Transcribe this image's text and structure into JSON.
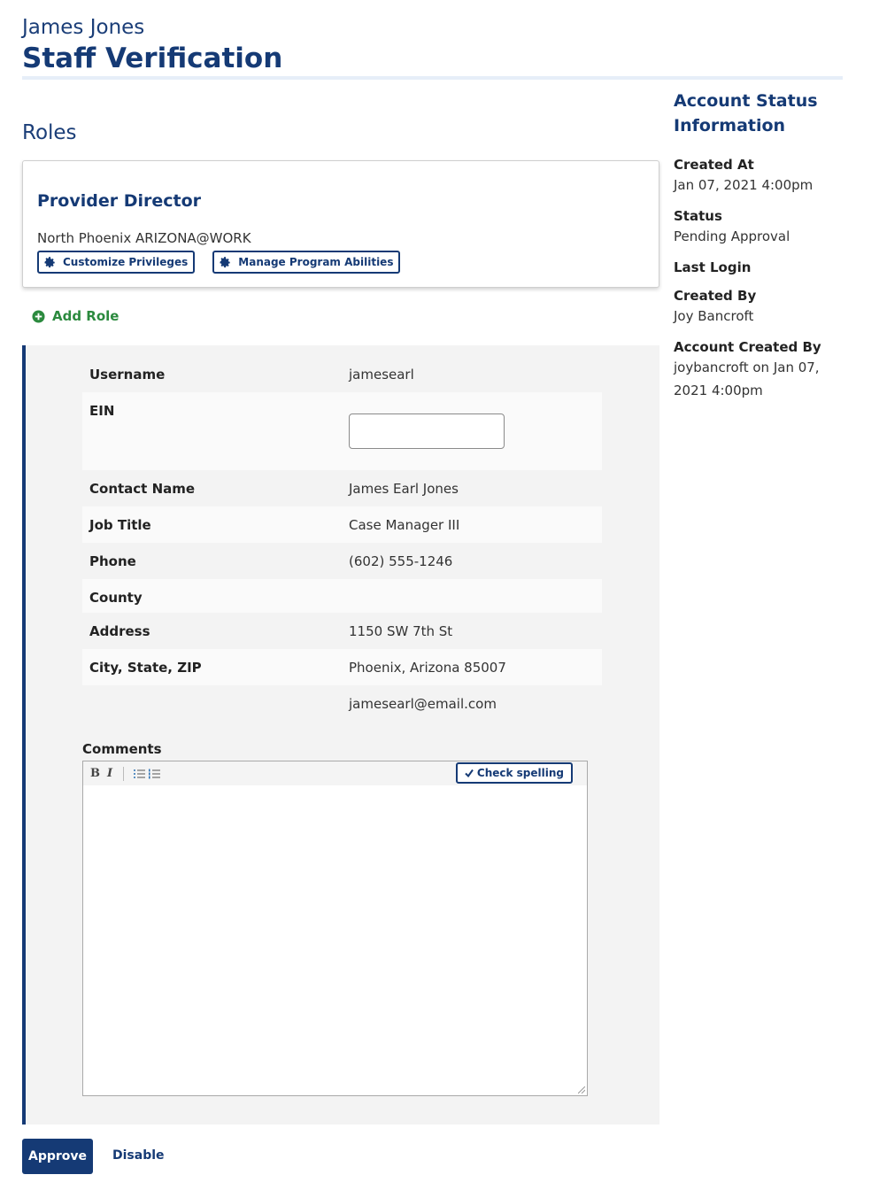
{
  "header": {
    "person_name": "James Jones",
    "page_title": "Staff Verification"
  },
  "roles": {
    "heading": "Roles",
    "items": [
      {
        "title": "Provider Director",
        "location": "North Phoenix ARIZONA@WORK",
        "customize_label": "Customize Privileges",
        "manage_label": "Manage Program Abilities"
      }
    ],
    "add_role_label": "Add Role"
  },
  "details": {
    "rows": [
      {
        "label": "Username",
        "value": "jamesearl"
      },
      {
        "label": "EIN",
        "value": ""
      },
      {
        "label": "Contact Name",
        "value": "James Earl Jones"
      },
      {
        "label": "Job Title",
        "value": "Case Manager III"
      },
      {
        "label": "Phone",
        "value": "(602) 555-1246"
      },
      {
        "label": "County",
        "value": ""
      },
      {
        "label": "Address",
        "value": "1150 SW 7th St"
      },
      {
        "label": "City, State, ZIP",
        "value": "Phoenix, Arizona 85007"
      },
      {
        "label": "",
        "value": "jamesearl@email.com"
      }
    ],
    "comments_label": "Comments",
    "toolbar": {
      "bold": "B",
      "italic": "I",
      "spell_label": "Check spelling"
    }
  },
  "actions": {
    "approve_label": "Approve",
    "disable_label": "Disable"
  },
  "sidebar": {
    "title": "Account Status Information",
    "items": [
      {
        "label": "Created At",
        "value": "Jan 07, 2021 4:00pm"
      },
      {
        "label": "Status",
        "value": "Pending Approval"
      },
      {
        "label": "Last Login",
        "value": ""
      },
      {
        "label": "Created By",
        "value": "Joy Bancroft"
      },
      {
        "label": "Account Created By",
        "value": "joybancroft on Jan 07, 2021 4:00pm"
      }
    ]
  },
  "colors": {
    "primary": "#153a75",
    "accent_green": "#2b8a3e",
    "panel_bg": "#f3f3f3"
  },
  "icons": {
    "customize": "gear-icon",
    "manage": "gear-icon",
    "add_role": "plus-circle-icon",
    "spell": "checkmark-icon",
    "list_unordered": "bullet-list-icon",
    "list_ordered": "numbered-list-icon"
  }
}
